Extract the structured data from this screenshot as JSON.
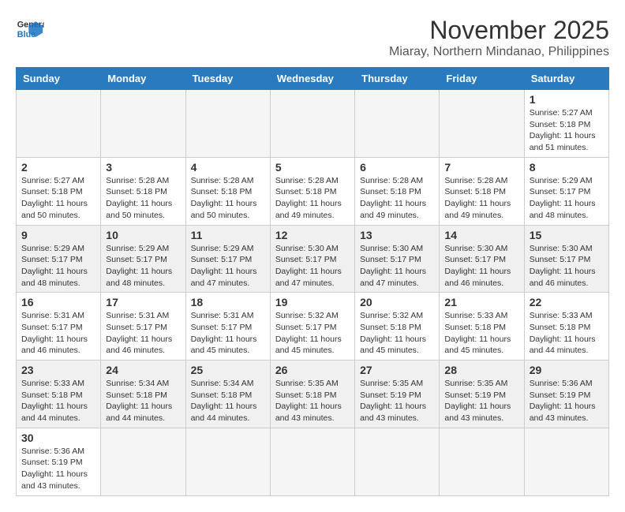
{
  "header": {
    "logo_general": "General",
    "logo_blue": "Blue",
    "title": "November 2025",
    "subtitle": "Miaray, Northern Mindanao, Philippines"
  },
  "weekdays": [
    "Sunday",
    "Monday",
    "Tuesday",
    "Wednesday",
    "Thursday",
    "Friday",
    "Saturday"
  ],
  "weeks": [
    [
      {
        "day": "",
        "info": ""
      },
      {
        "day": "",
        "info": ""
      },
      {
        "day": "",
        "info": ""
      },
      {
        "day": "",
        "info": ""
      },
      {
        "day": "",
        "info": ""
      },
      {
        "day": "",
        "info": ""
      },
      {
        "day": "1",
        "info": "Sunrise: 5:27 AM\nSunset: 5:18 PM\nDaylight: 11 hours and 51 minutes."
      }
    ],
    [
      {
        "day": "2",
        "info": "Sunrise: 5:27 AM\nSunset: 5:18 PM\nDaylight: 11 hours and 50 minutes."
      },
      {
        "day": "3",
        "info": "Sunrise: 5:28 AM\nSunset: 5:18 PM\nDaylight: 11 hours and 50 minutes."
      },
      {
        "day": "4",
        "info": "Sunrise: 5:28 AM\nSunset: 5:18 PM\nDaylight: 11 hours and 50 minutes."
      },
      {
        "day": "5",
        "info": "Sunrise: 5:28 AM\nSunset: 5:18 PM\nDaylight: 11 hours and 49 minutes."
      },
      {
        "day": "6",
        "info": "Sunrise: 5:28 AM\nSunset: 5:18 PM\nDaylight: 11 hours and 49 minutes."
      },
      {
        "day": "7",
        "info": "Sunrise: 5:28 AM\nSunset: 5:18 PM\nDaylight: 11 hours and 49 minutes."
      },
      {
        "day": "8",
        "info": "Sunrise: 5:29 AM\nSunset: 5:17 PM\nDaylight: 11 hours and 48 minutes."
      }
    ],
    [
      {
        "day": "9",
        "info": "Sunrise: 5:29 AM\nSunset: 5:17 PM\nDaylight: 11 hours and 48 minutes."
      },
      {
        "day": "10",
        "info": "Sunrise: 5:29 AM\nSunset: 5:17 PM\nDaylight: 11 hours and 48 minutes."
      },
      {
        "day": "11",
        "info": "Sunrise: 5:29 AM\nSunset: 5:17 PM\nDaylight: 11 hours and 47 minutes."
      },
      {
        "day": "12",
        "info": "Sunrise: 5:30 AM\nSunset: 5:17 PM\nDaylight: 11 hours and 47 minutes."
      },
      {
        "day": "13",
        "info": "Sunrise: 5:30 AM\nSunset: 5:17 PM\nDaylight: 11 hours and 47 minutes."
      },
      {
        "day": "14",
        "info": "Sunrise: 5:30 AM\nSunset: 5:17 PM\nDaylight: 11 hours and 46 minutes."
      },
      {
        "day": "15",
        "info": "Sunrise: 5:30 AM\nSunset: 5:17 PM\nDaylight: 11 hours and 46 minutes."
      }
    ],
    [
      {
        "day": "16",
        "info": "Sunrise: 5:31 AM\nSunset: 5:17 PM\nDaylight: 11 hours and 46 minutes."
      },
      {
        "day": "17",
        "info": "Sunrise: 5:31 AM\nSunset: 5:17 PM\nDaylight: 11 hours and 46 minutes."
      },
      {
        "day": "18",
        "info": "Sunrise: 5:31 AM\nSunset: 5:17 PM\nDaylight: 11 hours and 45 minutes."
      },
      {
        "day": "19",
        "info": "Sunrise: 5:32 AM\nSunset: 5:17 PM\nDaylight: 11 hours and 45 minutes."
      },
      {
        "day": "20",
        "info": "Sunrise: 5:32 AM\nSunset: 5:18 PM\nDaylight: 11 hours and 45 minutes."
      },
      {
        "day": "21",
        "info": "Sunrise: 5:33 AM\nSunset: 5:18 PM\nDaylight: 11 hours and 45 minutes."
      },
      {
        "day": "22",
        "info": "Sunrise: 5:33 AM\nSunset: 5:18 PM\nDaylight: 11 hours and 44 minutes."
      }
    ],
    [
      {
        "day": "23",
        "info": "Sunrise: 5:33 AM\nSunset: 5:18 PM\nDaylight: 11 hours and 44 minutes."
      },
      {
        "day": "24",
        "info": "Sunrise: 5:34 AM\nSunset: 5:18 PM\nDaylight: 11 hours and 44 minutes."
      },
      {
        "day": "25",
        "info": "Sunrise: 5:34 AM\nSunset: 5:18 PM\nDaylight: 11 hours and 44 minutes."
      },
      {
        "day": "26",
        "info": "Sunrise: 5:35 AM\nSunset: 5:18 PM\nDaylight: 11 hours and 43 minutes."
      },
      {
        "day": "27",
        "info": "Sunrise: 5:35 AM\nSunset: 5:19 PM\nDaylight: 11 hours and 43 minutes."
      },
      {
        "day": "28",
        "info": "Sunrise: 5:35 AM\nSunset: 5:19 PM\nDaylight: 11 hours and 43 minutes."
      },
      {
        "day": "29",
        "info": "Sunrise: 5:36 AM\nSunset: 5:19 PM\nDaylight: 11 hours and 43 minutes."
      }
    ],
    [
      {
        "day": "30",
        "info": "Sunrise: 5:36 AM\nSunset: 5:19 PM\nDaylight: 11 hours and 43 minutes."
      },
      {
        "day": "",
        "info": ""
      },
      {
        "day": "",
        "info": ""
      },
      {
        "day": "",
        "info": ""
      },
      {
        "day": "",
        "info": ""
      },
      {
        "day": "",
        "info": ""
      },
      {
        "day": "",
        "info": ""
      }
    ]
  ]
}
